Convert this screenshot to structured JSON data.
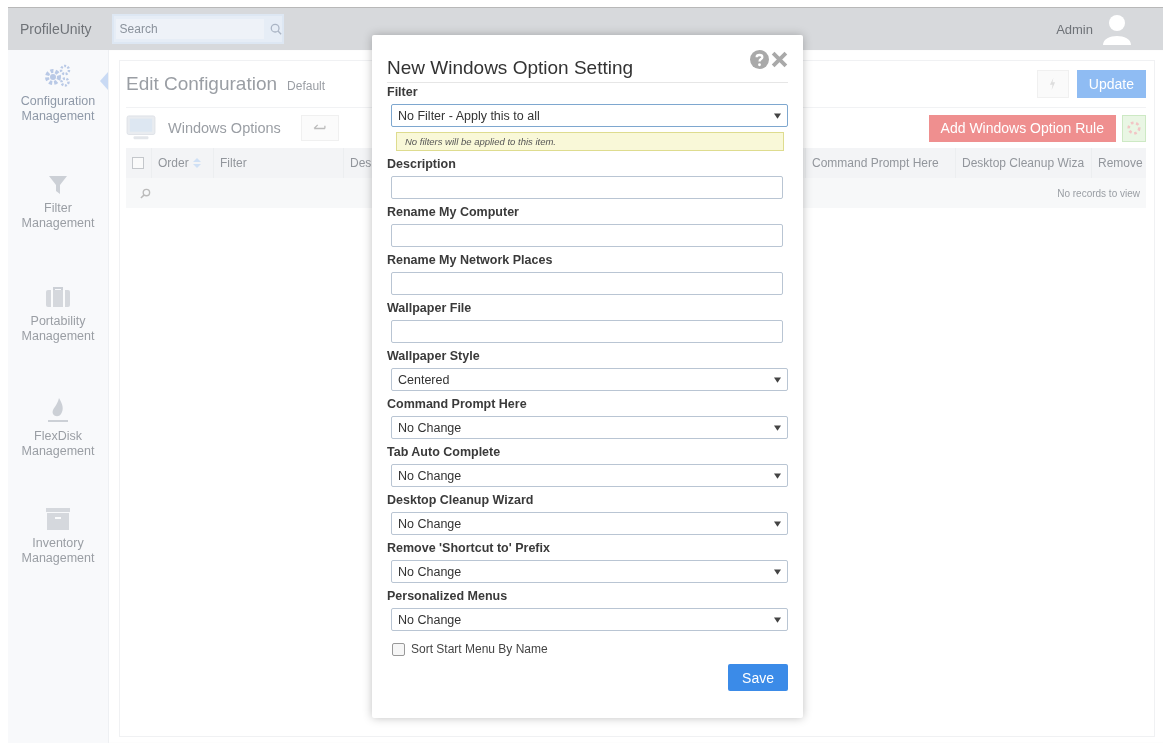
{
  "header": {
    "brand": "ProfileUnity",
    "search": {
      "placeholder": "Search"
    },
    "user": "Admin"
  },
  "sidebar": {
    "items": [
      {
        "label": "Configuration Management",
        "selected": true
      },
      {
        "label": "Filter Management",
        "selected": false
      },
      {
        "label": "Portability Management",
        "selected": false
      },
      {
        "label": "FlexDisk Management",
        "selected": false
      },
      {
        "label": "Inventory Management",
        "selected": false
      }
    ]
  },
  "page": {
    "title": "Edit Configuration",
    "subtitle": "Default",
    "update_button": "Update",
    "section_title": "Windows Options",
    "add_button": "Add Windows Option Rule",
    "table": {
      "select_all_checked": false,
      "columns": [
        "Order",
        "Filter",
        "Des",
        "Command Prompt Here",
        "Desktop Cleanup Wiza",
        "Remove"
      ],
      "empty_message": "No records to view"
    }
  },
  "dialog": {
    "title": "New Windows Option Setting",
    "fields": [
      {
        "kind": "select",
        "label": "Filter",
        "value": "No Filter - Apply this to all",
        "hint": "No filters will be applied to this item."
      },
      {
        "kind": "text",
        "label": "Description"
      },
      {
        "kind": "text",
        "label": "Rename My Computer"
      },
      {
        "kind": "text",
        "label": "Rename My Network Places"
      },
      {
        "kind": "text",
        "label": "Wallpaper File"
      },
      {
        "kind": "select",
        "label": "Wallpaper Style",
        "value": "Centered"
      },
      {
        "kind": "select",
        "label": "Command Prompt Here",
        "value": "No Change"
      },
      {
        "kind": "select",
        "label": "Tab Auto Complete",
        "value": "No Change"
      },
      {
        "kind": "select",
        "label": "Desktop Cleanup Wizard",
        "value": "No Change"
      },
      {
        "kind": "select",
        "label": "Remove 'Shortcut to' Prefix",
        "value": "No Change"
      },
      {
        "kind": "select",
        "label": "Personalized Menus",
        "value": "No Change"
      },
      {
        "kind": "checkbox",
        "label": "Sort Start Menu By Name",
        "checked": false
      }
    ],
    "save_button": "Save"
  }
}
